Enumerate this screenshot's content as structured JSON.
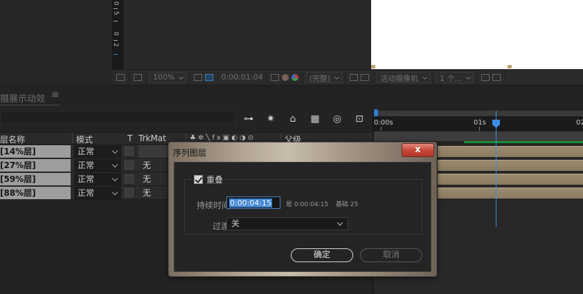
{
  "viewer": {
    "ruler_digits": [
      "0",
      "5",
      "0",
      "2",
      "5"
    ],
    "zoom": "100%",
    "timecode": "0:00:01:04",
    "resolution": "(完整)",
    "camera": "活动摄像机",
    "views": "1 个..."
  },
  "timeline": {
    "tab_label": "摄展示动效",
    "tab_menu": "≡",
    "col_name": "层名称",
    "col_mode": "模式",
    "col_t": "T",
    "col_trkmat": "TrkMat",
    "col_parent": "父级",
    "time_labels": [
      "0:00s",
      "01s",
      "02"
    ],
    "layers": [
      {
        "name": "[14%层]",
        "mode": "正常",
        "trkmat": ""
      },
      {
        "name": "[27%层]",
        "mode": "正常",
        "trkmat": "无"
      },
      {
        "name": "[59%层]",
        "mode": "正常",
        "trkmat": "无"
      },
      {
        "name": "[88%层]",
        "mode": "正常",
        "trkmat": "无"
      }
    ]
  },
  "dialog": {
    "title": "序列图层",
    "close_label": "x",
    "overlap_label": "重叠",
    "overlap_checked": true,
    "duration_label": "持续时间:",
    "duration_value": "0:00:04:15",
    "duration_note_equals": "是 0:00:04:15",
    "duration_note_base": "基础 25",
    "transition_label": "过渡:",
    "transition_value": "关",
    "ok_label": "确定",
    "cancel_label": "取消"
  },
  "colors": {
    "playhead": "#3b8ee6",
    "layer_bar": "#9a8a6e",
    "close_button": "#c9483a"
  }
}
